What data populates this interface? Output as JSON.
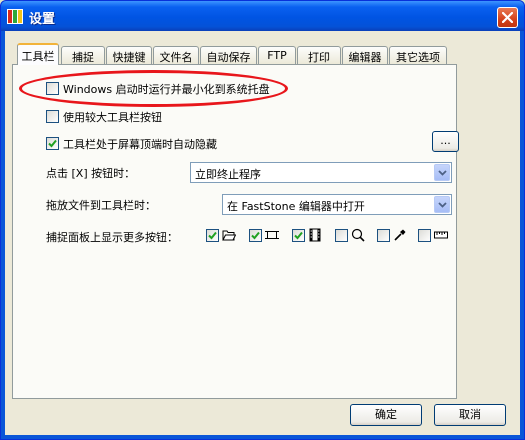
{
  "window": {
    "title": "设置",
    "accent": "#0054e3",
    "highlight_color": "#e8161b"
  },
  "tabs": [
    {
      "label": "工具栏",
      "active": true
    },
    {
      "label": "捕捉"
    },
    {
      "label": "快捷键"
    },
    {
      "label": "文件名"
    },
    {
      "label": "自动保存"
    },
    {
      "label": "FTP"
    },
    {
      "label": "打印"
    },
    {
      "label": "编辑器"
    },
    {
      "label": "其它选项"
    }
  ],
  "options": {
    "start_minimized": {
      "label": "Windows 启动时运行并最小化到系统托盘",
      "checked": false
    },
    "large_buttons": {
      "label": "使用较大工具栏按钮",
      "checked": false
    },
    "auto_hide": {
      "label": "工具栏处于屏幕顶端时自动隐藏",
      "checked": true
    },
    "more_button": "..."
  },
  "close_click": {
    "label": "点击 [X] 按钮时：",
    "value": "立即终止程序"
  },
  "drag_drop": {
    "label": "拖放文件到工具栏时：",
    "value": "在 FastStone 编辑器中打开"
  },
  "capture_panel": {
    "label": "捕捉面板上显示更多按钮：",
    "items": [
      {
        "icon": "folder-open-icon",
        "checked": true
      },
      {
        "icon": "rectangle-region-icon",
        "checked": true
      },
      {
        "icon": "film-video-icon",
        "checked": true
      },
      {
        "icon": "magnifier-icon",
        "checked": false
      },
      {
        "icon": "color-picker-icon",
        "checked": false
      },
      {
        "icon": "ruler-icon",
        "checked": false
      }
    ]
  },
  "buttons": {
    "ok": "确定",
    "cancel": "取消"
  }
}
